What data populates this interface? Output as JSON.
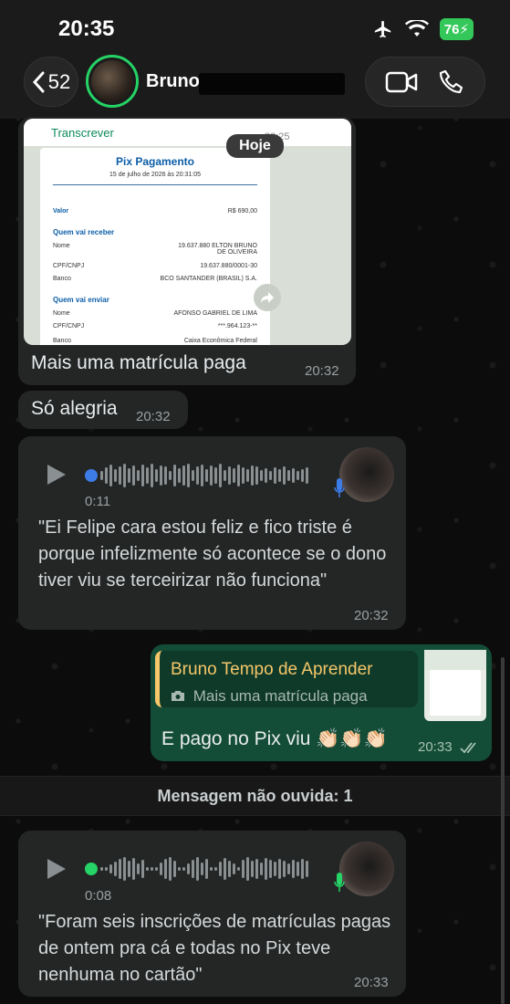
{
  "status_bar": {
    "time": "20:35",
    "battery": "76"
  },
  "header": {
    "back_count": "52",
    "contact_name": "Bruno"
  },
  "messages": {
    "image_caption": "Mais uma matrícula paga",
    "image_time": "20:32",
    "image_overlay_time": "20:25",
    "transcribe_label": "Transcrever",
    "date_badge": "Hoje",
    "pix": {
      "title": "Pix Pagamento",
      "date": "15 de julho de 2026 às 20:31:05",
      "valor_label": "Valor",
      "valor": "R$ 690,00",
      "receiver_section": "Quem vai receber",
      "receiver_rows": [
        {
          "label": "Nome",
          "value": "19.637.880 ELTON BRUNO DE OLIVEIRA"
        },
        {
          "label": "CPF/CNPJ",
          "value": "19.637.880/0001-30"
        },
        {
          "label": "Banco",
          "value": "BCO SANTANDER (BRASIL) S.A."
        }
      ],
      "sender_section": "Quem vai enviar",
      "sender_rows": [
        {
          "label": "Nome",
          "value": "AFONSO GABRIEL DE LIMA"
        },
        {
          "label": "CPF/CNPJ",
          "value": "***.964.123-**"
        },
        {
          "label": "Banco",
          "value": "Caixa Econômica Federal"
        }
      ]
    },
    "text1": "Só alegria",
    "text1_time": "20:32",
    "audio1": {
      "duration": "0:11",
      "transcript": "\"Ei Felipe cara estou feliz e fico triste é porque infelizmente só acontece se o dono tiver viu se terceirizar não funciona\"",
      "time": "20:32"
    },
    "out_reply": {
      "author": "Bruno Tempo de Aprender",
      "quoted": "Mais uma matrícula paga",
      "text": "E pago no Pix viu 👏🏻👏🏻👏🏻",
      "time": "20:33"
    },
    "unread_banner": "Mensagem não ouvida: 1",
    "audio2": {
      "duration": "0:08",
      "transcript": "\"Foram seis inscrições de matrículas pagas de ontem pra cá e todas no Pix teve nenhuma no cartão\"",
      "time": "20:33"
    }
  },
  "colors": {
    "accent": "#25d366",
    "outgoing": "#144d37",
    "incoming": "#242626",
    "quote_author": "#f5c66a",
    "unplayed_dot": "#3d7be6"
  }
}
